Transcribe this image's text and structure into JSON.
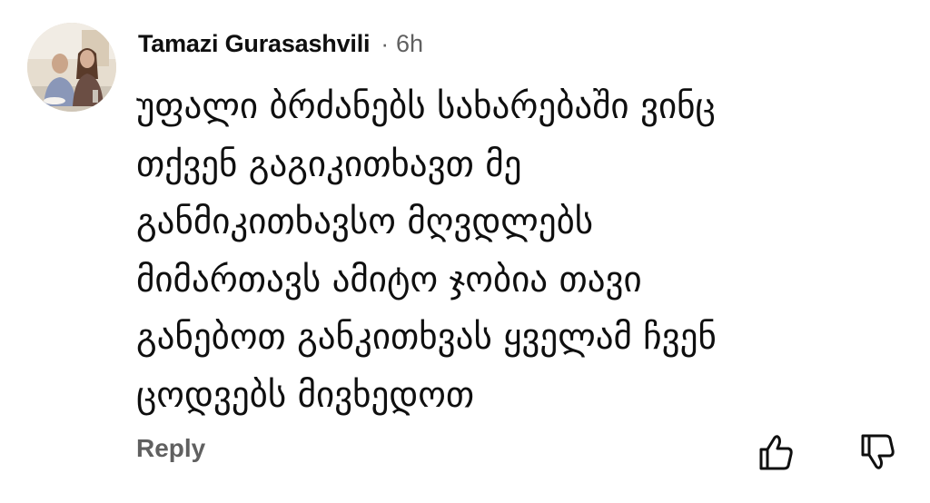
{
  "comment": {
    "author": "Tamazi Gurasashvili",
    "separator": "·",
    "time": "6h",
    "text_lines": [
      "უფალი ბრძანებს სახარებაში ვინც",
      "თქვენ გაგიკითხავთ მე",
      "განმიკითხავსო მღვდლებს",
      "მიმართავს ამიტო ჯობია თავი",
      "განებოთ განკითხვას ყველამ ჩვენ",
      "ცოდვებს მივხედოთ"
    ]
  },
  "actions": {
    "reply_label": "Reply"
  },
  "icons": {
    "avatar": "avatar-photo",
    "like": "thumbs-up-icon",
    "dislike": "thumbs-down-icon"
  },
  "colors": {
    "text": "#0f0f0f",
    "secondary": "#606060",
    "background": "#ffffff"
  }
}
